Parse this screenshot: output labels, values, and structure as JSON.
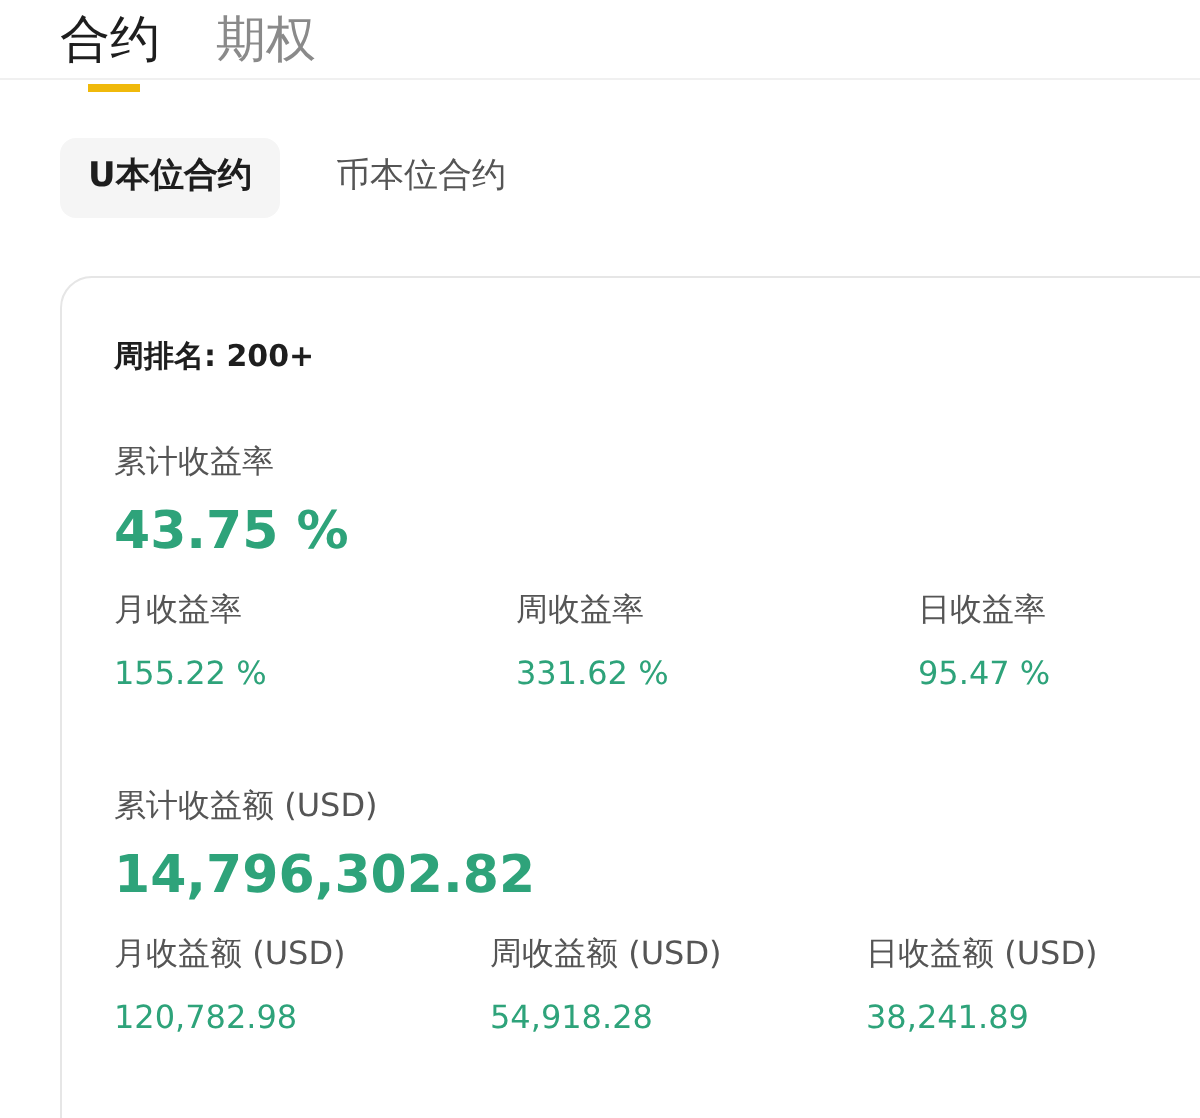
{
  "tabs": [
    {
      "label": "合约",
      "selected": true
    },
    {
      "label": "期权",
      "selected": false
    }
  ],
  "sub_tabs": [
    {
      "label": "U本位合约",
      "selected": true
    },
    {
      "label": "币本位合约",
      "selected": false
    }
  ],
  "card": {
    "rank": "周排名: 200+",
    "rate": {
      "label": "累计收益率",
      "value": "43.75 %",
      "items": [
        {
          "label": "月收益率",
          "value": "155.22 %"
        },
        {
          "label": "周收益率",
          "value": "331.62 %"
        },
        {
          "label": "日收益率",
          "value": "95.47 %"
        }
      ]
    },
    "amount": {
      "label": "累计收益额 (USD)",
      "value": "14,796,302.82",
      "items": [
        {
          "label": "月收益额 (USD)",
          "value": "120,782.98"
        },
        {
          "label": "周收益额 (USD)",
          "value": "54,918.28"
        },
        {
          "label": "日收益额 (USD)",
          "value": "38,241.89"
        }
      ]
    }
  }
}
